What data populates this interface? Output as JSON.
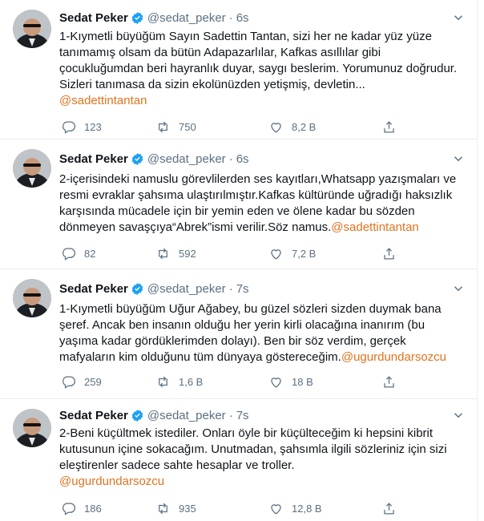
{
  "tweets": [
    {
      "name": "Sedat Peker",
      "handle": "@sedat_peker",
      "dot": "·",
      "time": "6s",
      "text": "1-Kıymetli büyüğüm Sayın Sadettin Tantan, sizi her ne kadar yüz yüze tanımamış olsam da bütün Adapazarlılar, Kafkas asıllılar gibi çocukluğumdan beri hayranlık duyar, saygı beslerim. Yorumunuz doğrudur. Sizleri tanımasa da sizin ekolünüzden yetişmiş, devletin...",
      "mention": "@sadettintantan",
      "replies": "123",
      "retweets": "750",
      "likes": "8,2 B"
    },
    {
      "name": "Sedat Peker",
      "handle": "@sedat_peker",
      "dot": "·",
      "time": "6s",
      "text": "2-içerisindeki namuslu görevlilerden ses kayıtları,Whatsapp yazışmaları ve resmi evraklar şahsıma ulaştırılmıştır.Kafkas kültüründe uğradığı haksızlık karşısında mücadele için bir yemin eden ve ölene kadar bu sözden dönmeyen savaşçıya“Abrek”ismi verilir.Söz namus.",
      "mention": "@sadettintantan",
      "replies": "82",
      "retweets": "592",
      "likes": "7,2 B"
    },
    {
      "name": "Sedat Peker",
      "handle": "@sedat_peker",
      "dot": "·",
      "time": "7s",
      "text": "1-Kıymetli büyüğüm Uğur Ağabey, bu güzel sözleri sizden duymak bana şeref. Ancak ben insanın olduğu her yerin kirli olacağına inanırım (bu yaşıma kadar gördüklerimden dolayı). Ben bir söz verdim, gerçek mafyaların kim olduğunu tüm dünyaya göstereceğim.",
      "mention": "@ugurdundarsozcu",
      "replies": "259",
      "retweets": "1,6 B",
      "likes": "18 B"
    },
    {
      "name": "Sedat Peker",
      "handle": "@sedat_peker",
      "dot": "·",
      "time": "7s",
      "text": "2-Beni küçültmek istediler. Onları öyle bir küçülteceğim ki hepsini kibrit kutusunun içine sokacağım. Unutmadan, şahsımla ilgili sözleriniz için sizi eleştirenler sadece sahte hesaplar ve troller.",
      "mention": "@ugurdundarsozcu",
      "replies": "186",
      "retweets": "935",
      "likes": "12,8 B"
    }
  ],
  "colors": {
    "accent": "#1da1f2",
    "mention": "#e0731f",
    "muted": "#5b7083"
  }
}
